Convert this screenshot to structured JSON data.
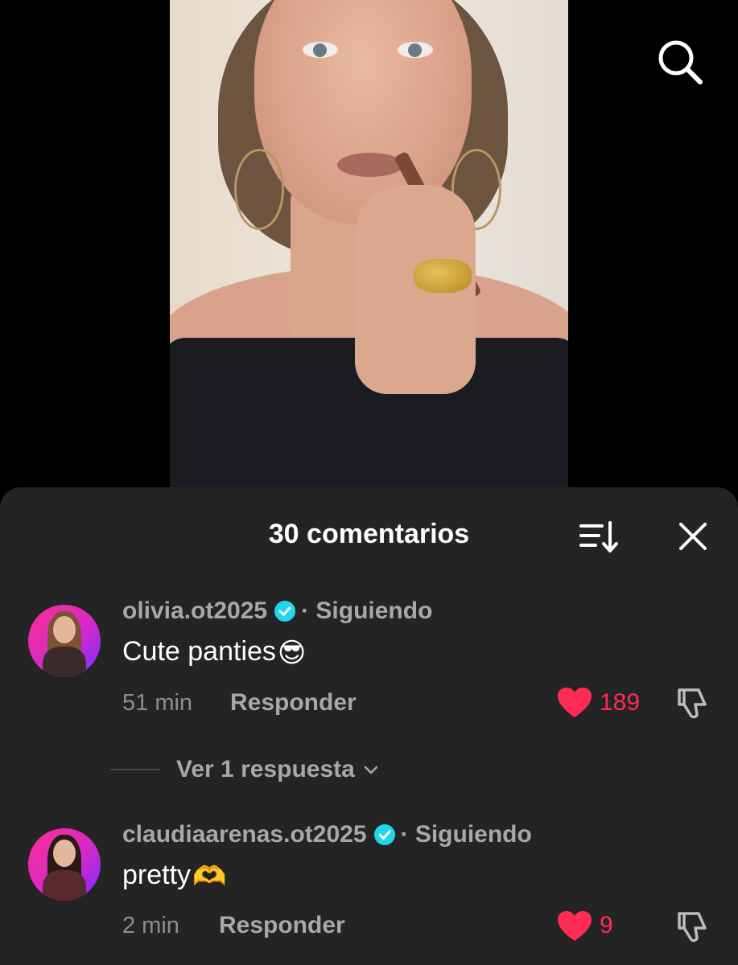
{
  "header": {
    "search_icon": "search-icon"
  },
  "comments_sheet": {
    "title": "30 comentarios",
    "sort_icon": "sort-icon",
    "close_icon": "close-icon",
    "comments": [
      {
        "username": "olivia.ot2025",
        "verified": true,
        "relationship": "· Siguiendo",
        "text": "Cute panties",
        "emoji": "😎",
        "time": "51 min",
        "reply_label": "Responder",
        "likes": "189",
        "liked": true
      },
      {
        "username": "claudiaarenas.ot2025",
        "verified": true,
        "relationship": "· Siguiendo",
        "text": "pretty",
        "emoji": "🫶",
        "time": "2 min",
        "reply_label": "Responder",
        "likes": "9",
        "liked": true
      }
    ],
    "view_replies_label": "Ver 1 respuesta"
  },
  "colors": {
    "sheet_background": "#242424",
    "like_red": "#fe2c55",
    "verified_blue": "#20d5ec",
    "avatar_gradient_start": "#ff2d8f",
    "avatar_gradient_end": "#7a2bff"
  }
}
